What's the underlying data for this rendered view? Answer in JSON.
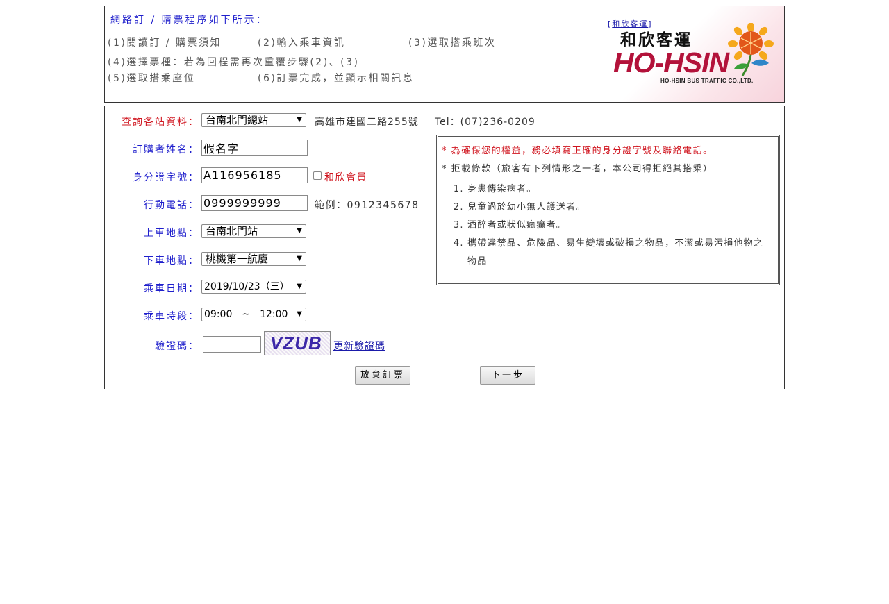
{
  "steps": {
    "title": "網路訂 / 購票程序如下所示：",
    "items": [
      "(1)閱讀訂 / 購票須知",
      "(2)輸入乘車資訊",
      "(3)選取搭乘班次",
      "(4)選擇票種：若為回程需再次重覆步驟(2)、(3)",
      "(5)選取搭乘座位",
      "(6)訂票完成，並顯示相關訊息"
    ]
  },
  "logo": {
    "link_prefix": "[",
    "link_text": "和欣客運",
    "link_suffix": "]",
    "name_cn": "和欣客運",
    "name_en": "HO-HSIN",
    "subtitle": "HO-HSIN BUS TRAFFIC CO.,LTD."
  },
  "form": {
    "station_info": {
      "label": "查詢各站資料：",
      "value": "台南北門總站",
      "address": "高雄市建國二路255號",
      "tel": "Tel：(07)236-0209"
    },
    "name": {
      "label": "訂購者姓名：",
      "value": "假名字"
    },
    "id_number": {
      "label": "身分證字號：",
      "value": "A116956185",
      "member_label": "和欣會員"
    },
    "mobile": {
      "label": "行動電話：",
      "value": "0999999999",
      "example": "範例：0912345678"
    },
    "boarding": {
      "label": "上車地點：",
      "value": "台南北門站"
    },
    "alighting": {
      "label": "下車地點：",
      "value": "桃機第一航廈"
    },
    "date": {
      "label": "乘車日期：",
      "value": "2019/10/23（三）"
    },
    "time": {
      "label": "乘車時段：",
      "value": "09:00　~　12:00"
    },
    "captcha": {
      "label": "驗證碼：",
      "value": "",
      "image_text": "VZUB",
      "refresh_link": "更新驗證碼"
    }
  },
  "notice": {
    "warning": "* 為確保您的權益，務必填寫正確的身分證字號及聯絡電話。",
    "refusal_title": "* 拒載條款（旅客有下列情形之一者，本公司得拒絕其搭乘）",
    "rules": [
      "身患傳染病者。",
      "兒童過於幼小無人護送者。",
      "酒醉者或狀似瘋癲者。",
      "攜帶違禁品、危險品、易生變壞或破損之物品，不潔或易污損他物之物品"
    ]
  },
  "buttons": {
    "cancel": "放棄訂票",
    "next": "下一步"
  },
  "colors": {
    "label_blue": "#1f1fcc",
    "label_red": "#d0141e",
    "brand_red": "#b3123a"
  },
  "icons": {
    "dropdown": "chevron-down-icon",
    "logo": "sunflower-logo-icon"
  }
}
